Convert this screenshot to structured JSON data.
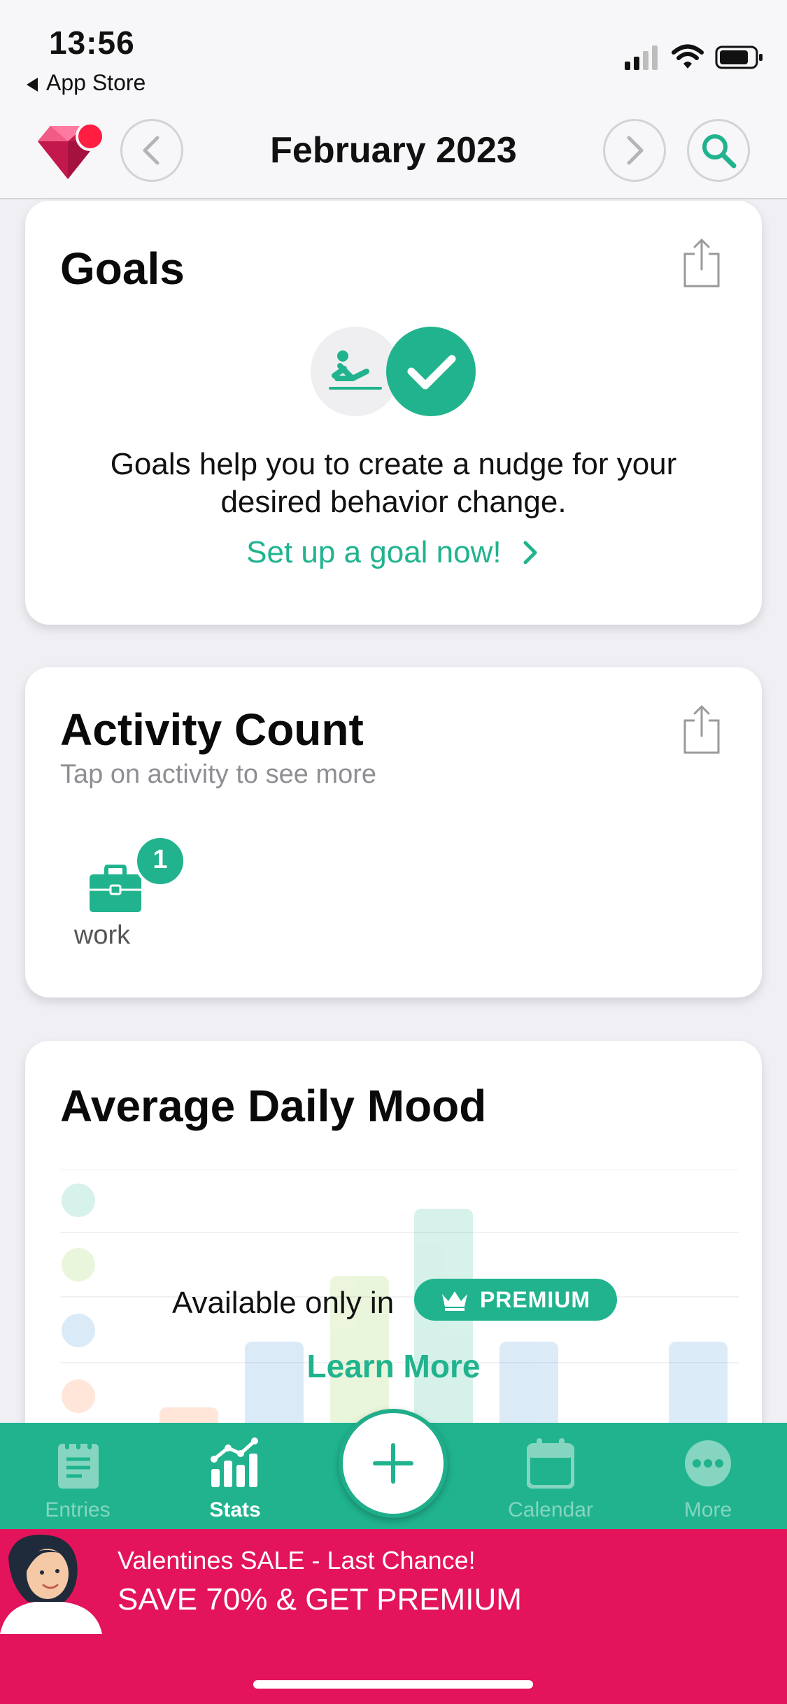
{
  "status_bar": {
    "time": "13:56",
    "back_label": "App Store"
  },
  "header": {
    "title": "February 2023"
  },
  "goals_card": {
    "title": "Goals",
    "description": "Goals help you to create a nudge for your desired behavior change.",
    "link_label": "Set up a goal now!"
  },
  "activity_card": {
    "title": "Activity Count",
    "subtitle": "Tap on activity to see more",
    "items": [
      {
        "label": "work",
        "count": "1",
        "icon": "briefcase-icon"
      }
    ]
  },
  "mood_card": {
    "title": "Average Daily Mood",
    "available_text": "Available only in",
    "premium_label": "PREMIUM",
    "learn_more": "Learn More"
  },
  "tabs": [
    {
      "label": "Entries",
      "icon": "notepad-icon",
      "active": false
    },
    {
      "label": "Stats",
      "icon": "chart-icon",
      "active": true
    },
    {
      "label": "Calendar",
      "icon": "calendar-icon",
      "active": false
    },
    {
      "label": "More",
      "icon": "ellipsis-icon",
      "active": false
    }
  ],
  "promo": {
    "line1": "Valentines SALE - Last Chance!",
    "line2": "SAVE 70% & GET PREMIUM"
  },
  "colors": {
    "accent": "#20b38e",
    "promo": "#e3145b",
    "gem": "#e0245e"
  }
}
